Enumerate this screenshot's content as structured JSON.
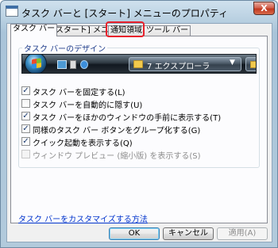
{
  "window": {
    "title": "タスク バーと [スタート] メニューのプロパティ",
    "close_label": "X"
  },
  "tabs": [
    {
      "label": "タスク バー",
      "active": true
    },
    {
      "label": "[スタート] メニュー",
      "active": false
    },
    {
      "label": "通知領域",
      "active": false,
      "highlighted": true
    },
    {
      "label": "ツール バー",
      "active": false
    }
  ],
  "highlight_color": "#e8202b",
  "appearance_group": {
    "label": "タスク バーのデザイン",
    "preview": {
      "taskbar_button_label": "エクスプローラ",
      "taskbar_button_count": "7",
      "taskbar_button_icon": "folder-icon",
      "dropdown_arrow": "▼"
    }
  },
  "options": [
    {
      "label": "タスク バーを固定する(L)",
      "checked": true,
      "enabled": true
    },
    {
      "label": "タスク バーを自動的に隠す(U)",
      "checked": false,
      "enabled": true
    },
    {
      "label": "タスク バーをほかのウィンドウの手前に表示する(T)",
      "checked": true,
      "enabled": true
    },
    {
      "label": "同様のタスク バー ボタンをグループ化する(G)",
      "checked": true,
      "enabled": true
    },
    {
      "label": "クイック起動を表示する(Q)",
      "checked": true,
      "enabled": true
    },
    {
      "label": "ウィンドウ プレビュー (縮小版) を表示する(S)",
      "checked": false,
      "enabled": false
    }
  ],
  "check_glyph": "✓",
  "customize_link": "タスク バーをカスタマイズする方法",
  "buttons": {
    "ok": "OK",
    "cancel": "キャンセル",
    "apply": "適用(A)"
  }
}
